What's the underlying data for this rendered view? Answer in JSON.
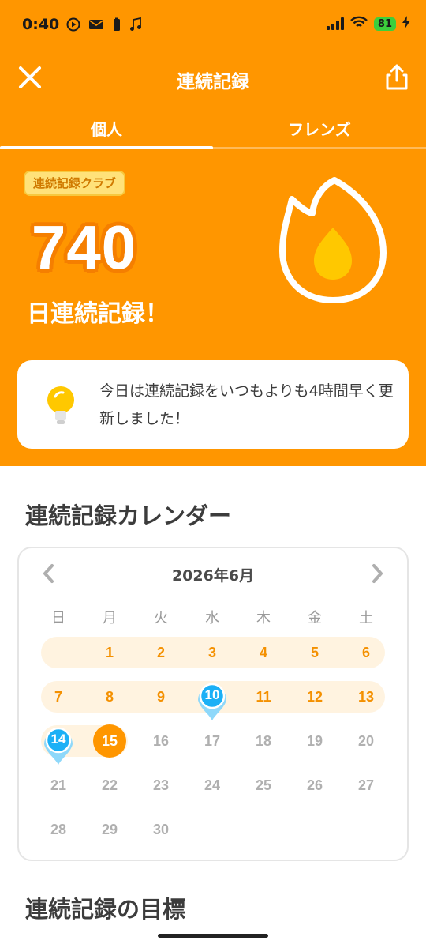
{
  "status_bar": {
    "time": "0:40",
    "battery": "81"
  },
  "header": {
    "title": "連続記録"
  },
  "tabs": [
    {
      "label": "個人"
    },
    {
      "label": "フレンズ"
    }
  ],
  "hero": {
    "badge": "連続記録クラブ",
    "days": "740",
    "days_label": "日連続記録！"
  },
  "tip": {
    "text": "今日は連続記録をいつもよりも4時間早く更新しました！"
  },
  "calendar": {
    "section_title": "連続記録カレンダー",
    "month": "2026年6月",
    "weekdays": [
      "日",
      "月",
      "火",
      "水",
      "木",
      "金",
      "土"
    ],
    "rows": [
      [
        "",
        "1",
        "2",
        "3",
        "4",
        "5",
        "6"
      ],
      [
        "7",
        "8",
        "9",
        "10",
        "11",
        "12",
        "13"
      ],
      [
        "14",
        "15",
        "16",
        "17",
        "18",
        "19",
        "20"
      ],
      [
        "21",
        "22",
        "23",
        "24",
        "25",
        "26",
        "27"
      ],
      [
        "28",
        "29",
        "30",
        "",
        "",
        "",
        ""
      ]
    ],
    "today": "15",
    "freeze_days": [
      "10",
      "14"
    ]
  },
  "goals": {
    "section_title": "連続記録の目標"
  },
  "colors": {
    "brand_orange": "#FF9600",
    "streak_text": "#F49000",
    "freeze_blue": "#1CB0F6",
    "badge_yellow": "#FFE27A"
  }
}
